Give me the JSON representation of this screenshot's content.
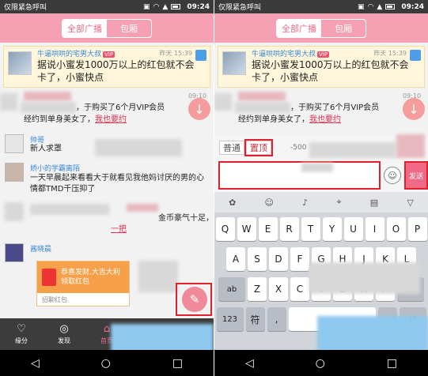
{
  "status_bar": {
    "carrier": "仅限紧急呼叫",
    "time": "09:24"
  },
  "header": {
    "tab_all": "全部广播",
    "tab_packet": "包厢"
  },
  "banner": {
    "name": "牛逼哄哄的宅男大叔",
    "vip": "VIP",
    "time": "昨天 15:39",
    "text": "据说小蜜发1000万以上的红包就不会卡了，小蜜快点"
  },
  "feed": {
    "msg1_time": "09:10",
    "msg1_text_a": "，于购买了6个月VIP会员",
    "msg1_text_b": "经约到单身美女了，",
    "msg1_link": "我也要约",
    "user2_name": "帅哥",
    "user2_text": "新人求罩",
    "user3_name": "娇小的学霸离陌",
    "user3_text": "一天早晨起来看看大于就看见我他妈讨厌的男的心情都TMD千压抑了",
    "msg4_text": "金币豪气十足，正在",
    "msg4_link": "一把",
    "user5_name": "酱晓晨",
    "redpack_line1": "恭喜发财,大吉大利",
    "redpack_line2": "领取红包",
    "redpack_footer": "招聊红包"
  },
  "bottom_nav": {
    "item1": "缘分",
    "item2": "发现",
    "item3": "首页"
  },
  "right_input": {
    "type_normal": "普通",
    "type_top": "置顶",
    "counter": "-500",
    "send_label": "发送"
  },
  "keyboard": {
    "row1": [
      "Q",
      "W",
      "E",
      "R",
      "T",
      "Y",
      "U",
      "I",
      "O",
      "P"
    ],
    "row2": [
      "A",
      "S",
      "D",
      "F",
      "G",
      "H",
      "J",
      "K",
      "L"
    ],
    "row3": [
      "Z",
      "X",
      "C",
      "V",
      "B",
      "N",
      "M"
    ],
    "row3_left": "ab",
    "row4_left": "123",
    "row4_key2": "符"
  },
  "colors": {
    "accent": "#f06a86",
    "highlight": "#e0202a"
  },
  "icons": [
    "heart-icon",
    "compass-icon",
    "home-icon",
    "edit-icon",
    "arrow-down-icon",
    "smile-icon",
    "back-icon",
    "backspace-icon"
  ]
}
